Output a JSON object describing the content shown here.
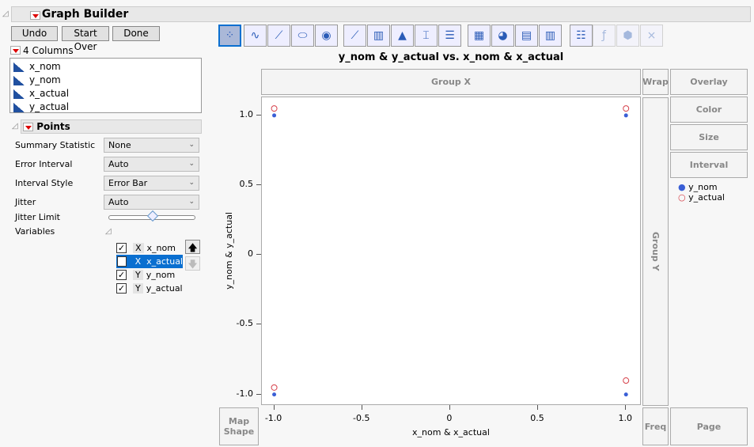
{
  "title": "Graph Builder",
  "buttons": {
    "undo": "Undo",
    "start_over": "Start Over",
    "done": "Done"
  },
  "columns": {
    "header": "4 Columns",
    "items": [
      "x_nom",
      "y_nom",
      "x_actual",
      "y_actual"
    ]
  },
  "points_panel": {
    "title": "Points",
    "fields": [
      {
        "label": "Summary Statistic",
        "value": "None"
      },
      {
        "label": "Error Interval",
        "value": "Auto"
      },
      {
        "label": "Interval Style",
        "value": "Error Bar"
      },
      {
        "label": "Jitter",
        "value": "Auto"
      }
    ],
    "jitter_limit_label": "Jitter Limit",
    "jitter_limit_value": 0.5,
    "variables_label": "Variables",
    "variables": [
      {
        "role": "X",
        "name": "x_nom",
        "checked": true,
        "selected": false
      },
      {
        "role": "X",
        "name": "x_actual",
        "checked": false,
        "selected": true
      },
      {
        "role": "Y",
        "name": "y_nom",
        "checked": true,
        "selected": false
      },
      {
        "role": "Y",
        "name": "y_actual",
        "checked": true,
        "selected": false
      }
    ]
  },
  "toolbar": [
    "points-icon",
    "smoother-icon",
    "line-of-fit-icon",
    "ellipse-icon",
    "contour-icon",
    "line-icon",
    "bar-icon",
    "area-icon",
    "box-plot-icon",
    "histogram-icon",
    "heatmap-icon",
    "pie-icon",
    "treemap-icon",
    "mosaic-icon",
    "caption-box-icon",
    "formula-icon",
    "map-shapes-icon",
    "parallel-icon"
  ],
  "graph": {
    "title": "y_nom & y_actual vs. x_nom & x_actual",
    "xlabel": "x_nom & x_actual",
    "ylabel": "y_nom & y_actual",
    "zones": {
      "group_x": "Group X",
      "group_y": "Group Y",
      "wrap": "Wrap",
      "overlay": "Overlay",
      "color": "Color",
      "size": "Size",
      "interval": "Interval",
      "map_shape": "Map Shape",
      "freq": "Freq",
      "page": "Page"
    },
    "xticks": [
      "-1.0",
      "-0.5",
      "0",
      "0.5",
      "1.0"
    ],
    "yticks": [
      "1.0",
      "0.5",
      "0",
      "-0.5",
      "-1.0"
    ],
    "legend": [
      {
        "name": "y_nom",
        "color": "#3a5fd6",
        "marker": "dot"
      },
      {
        "name": "y_actual",
        "color": "#d6404a",
        "marker": "circle"
      }
    ]
  },
  "chart_data": {
    "type": "scatter",
    "xlim": [
      -1.07,
      1.08
    ],
    "ylim": [
      -1.07,
      1.13
    ],
    "series": [
      {
        "name": "y_nom",
        "x": [
          -1,
          1,
          -1,
          1
        ],
        "y": [
          1,
          1,
          -1,
          -1
        ]
      },
      {
        "name": "y_actual",
        "x": [
          -1,
          1,
          -1,
          1
        ],
        "y": [
          1.05,
          1.05,
          -0.95,
          -0.9
        ]
      }
    ]
  }
}
